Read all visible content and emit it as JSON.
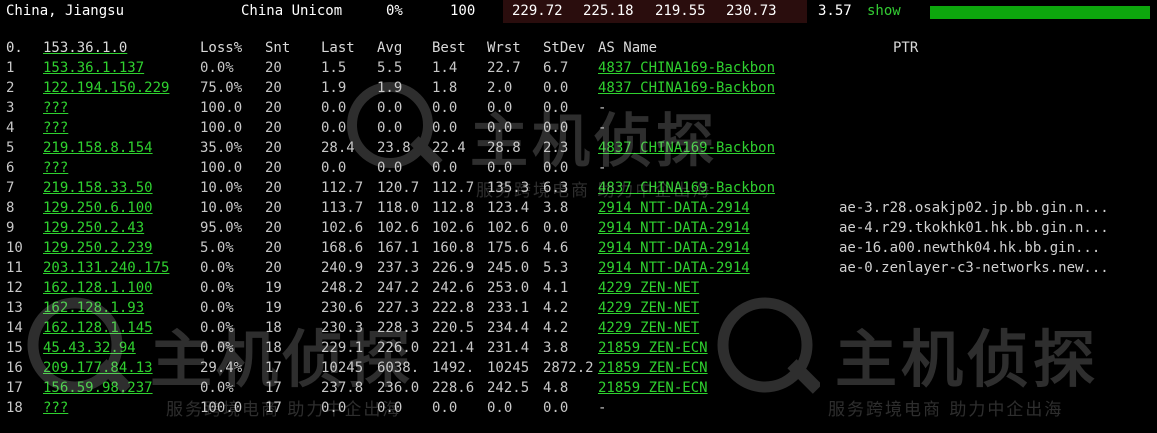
{
  "top": {
    "location": "China, Jiangsu",
    "isp": "China Unicom",
    "loss": "0%",
    "count": "100",
    "v1": "229.72",
    "v2": "225.18",
    "v3": "219.55",
    "v4": "230.73",
    "v5": "3.57",
    "show_label": "show",
    "bar_fraction": 1.0,
    "bar_color": "#0da70d",
    "highlight_color": "#2a0d0d"
  },
  "header": {
    "hop": "0.",
    "host": "153.36.1.0",
    "loss": "Loss%",
    "snt": "Snt",
    "last": "Last",
    "avg": "Avg",
    "best": "Best",
    "wrst": "Wrst",
    "stdev": "StDev",
    "asname": "AS Name",
    "ptr": "PTR"
  },
  "rows": [
    {
      "hop": "1",
      "host": "153.36.1.137",
      "loss": "0.0%",
      "snt": "20",
      "last": "1.5",
      "avg": "5.5",
      "best": "1.4",
      "wrst": "22.7",
      "stdev": "6.7",
      "asname": "4837  CHINA169-Backbon",
      "ptr": ""
    },
    {
      "hop": "2",
      "host": "122.194.150.229",
      "loss": "75.0%",
      "snt": "20",
      "last": "1.9",
      "avg": "1.9",
      "best": "1.8",
      "wrst": "2.0",
      "stdev": "0.0",
      "asname": "4837  CHINA169-Backbon",
      "ptr": ""
    },
    {
      "hop": "3",
      "host": "???",
      "loss": "100.0",
      "snt": "20",
      "last": "0.0",
      "avg": "0.0",
      "best": "0.0",
      "wrst": "0.0",
      "stdev": "0.0",
      "asname": "-",
      "ptr": ""
    },
    {
      "hop": "4",
      "host": "???",
      "loss": "100.0",
      "snt": "20",
      "last": "0.0",
      "avg": "0.0",
      "best": "0.0",
      "wrst": "0.0",
      "stdev": "0.0",
      "asname": "-",
      "ptr": ""
    },
    {
      "hop": "5",
      "host": "219.158.8.154",
      "loss": "35.0%",
      "snt": "20",
      "last": "28.4",
      "avg": "23.8",
      "best": "22.4",
      "wrst": "28.8",
      "stdev": "2.3",
      "asname": "4837  CHINA169-Backbon",
      "ptr": ""
    },
    {
      "hop": "6",
      "host": "???",
      "loss": "100.0",
      "snt": "20",
      "last": "0.0",
      "avg": "0.0",
      "best": "0.0",
      "wrst": "0.0",
      "stdev": "0.0",
      "asname": "-",
      "ptr": ""
    },
    {
      "hop": "7",
      "host": "219.158.33.50",
      "loss": "10.0%",
      "snt": "20",
      "last": "112.7",
      "avg": "120.7",
      "best": "112.7",
      "wrst": "135.3",
      "stdev": "6.3",
      "asname": "4837  CHINA169-Backbon",
      "ptr": ""
    },
    {
      "hop": "8",
      "host": "129.250.6.100",
      "loss": "10.0%",
      "snt": "20",
      "last": "113.7",
      "avg": "118.0",
      "best": "112.8",
      "wrst": "123.4",
      "stdev": "3.8",
      "asname": "2914  NTT-DATA-2914",
      "ptr": "ae-3.r28.osakjp02.jp.bb.gin.n..."
    },
    {
      "hop": "9",
      "host": "129.250.2.43",
      "loss": "95.0%",
      "snt": "20",
      "last": "102.6",
      "avg": "102.6",
      "best": "102.6",
      "wrst": "102.6",
      "stdev": "0.0",
      "asname": "2914  NTT-DATA-2914",
      "ptr": "ae-4.r29.tkokhk01.hk.bb.gin.n..."
    },
    {
      "hop": "10",
      "host": "129.250.2.239",
      "loss": "5.0%",
      "snt": "20",
      "last": "168.6",
      "avg": "167.1",
      "best": "160.8",
      "wrst": "175.6",
      "stdev": "4.6",
      "asname": "2914  NTT-DATA-2914",
      "ptr": "ae-16.a00.newthk04.hk.bb.gin..."
    },
    {
      "hop": "11",
      "host": "203.131.240.175",
      "loss": "0.0%",
      "snt": "20",
      "last": "240.9",
      "avg": "237.3",
      "best": "226.9",
      "wrst": "245.0",
      "stdev": "5.3",
      "asname": "2914  NTT-DATA-2914",
      "ptr": "ae-0.zenlayer-c3-networks.new..."
    },
    {
      "hop": "12",
      "host": "162.128.1.100",
      "loss": "0.0%",
      "snt": "19",
      "last": "248.2",
      "avg": "247.2",
      "best": "242.6",
      "wrst": "253.0",
      "stdev": "4.1",
      "asname": "4229  ZEN-NET",
      "ptr": ""
    },
    {
      "hop": "13",
      "host": "162.128.1.93",
      "loss": "0.0%",
      "snt": "19",
      "last": "230.6",
      "avg": "227.3",
      "best": "222.8",
      "wrst": "233.1",
      "stdev": "4.2",
      "asname": "4229  ZEN-NET",
      "ptr": ""
    },
    {
      "hop": "14",
      "host": "162.128.1.145",
      "loss": "0.0%",
      "snt": "18",
      "last": "230.3",
      "avg": "228.3",
      "best": "220.5",
      "wrst": "234.4",
      "stdev": "4.2",
      "asname": "4229  ZEN-NET",
      "ptr": ""
    },
    {
      "hop": "15",
      "host": "45.43.32.94",
      "loss": "0.0%",
      "snt": "18",
      "last": "229.1",
      "avg": "226.0",
      "best": "221.4",
      "wrst": "231.4",
      "stdev": "3.8",
      "asname": "21859 ZEN-ECN",
      "ptr": ""
    },
    {
      "hop": "16",
      "host": "209.177.84.13",
      "loss": "29.4%",
      "snt": "17",
      "last": "10245",
      "avg": "6038.",
      "best": "1492.",
      "wrst": "10245",
      "stdev": "2872.2",
      "asname": "21859 ZEN-ECN",
      "ptr": ""
    },
    {
      "hop": "17",
      "host": "156.59.98.237",
      "loss": "0.0%",
      "snt": "17",
      "last": "237.8",
      "avg": "236.0",
      "best": "228.6",
      "wrst": "242.5",
      "stdev": "4.8",
      "asname": "21859 ZEN-ECN",
      "ptr": ""
    },
    {
      "hop": "18",
      "host": "???",
      "loss": "100.0",
      "snt": "17",
      "last": "0.0",
      "avg": "0.0",
      "best": "0.0",
      "wrst": "0.0",
      "stdev": "0.0",
      "asname": "-",
      "ptr": ""
    }
  ],
  "watermark": {
    "title": "主机侦探",
    "subtitle": "服务跨境电商 助力中企出海"
  }
}
